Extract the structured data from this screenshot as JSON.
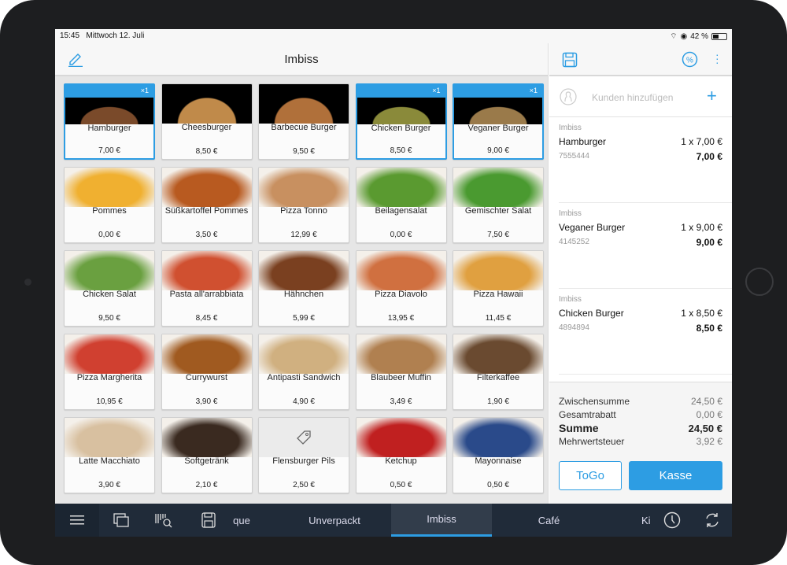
{
  "status": {
    "time": "15:45",
    "date": "Mittwoch 12. Juli",
    "battery": "42 %"
  },
  "left": {
    "title": "Imbiss",
    "icon": "pencil-icon"
  },
  "products": [
    {
      "name": "Hamburger",
      "price": "7,00 €",
      "qty": "×1",
      "selected": true,
      "color": "#7a4a2a"
    },
    {
      "name": "Cheesburger",
      "price": "8,50 €",
      "selected": false,
      "color": "#c08a4a"
    },
    {
      "name": "Barbecue Burger",
      "price": "9,50 €",
      "selected": false,
      "color": "#b0703a"
    },
    {
      "name": "Chicken Burger",
      "price": "8,50 €",
      "qty": "×1",
      "selected": true,
      "color": "#8a8a3a"
    },
    {
      "name": "Veganer Burger",
      "price": "9,00 €",
      "qty": "×1",
      "selected": true,
      "color": "#9a7a4a"
    },
    {
      "name": "Pommes",
      "price": "0,00 €",
      "selected": false,
      "color": "#f0b030"
    },
    {
      "name": "Süßkartoffel Pommes",
      "price": "3,50 €",
      "selected": false,
      "color": "#b85a20"
    },
    {
      "name": "Pizza Tonno",
      "price": "12,99 €",
      "selected": false,
      "color": "#c89060"
    },
    {
      "name": "Beilagensalat",
      "price": "0,00 €",
      "selected": false,
      "color": "#5a9a30"
    },
    {
      "name": "Gemischter Salat",
      "price": "7,50 €",
      "selected": false,
      "color": "#4a9a30"
    },
    {
      "name": "Chicken Salat",
      "price": "9,50 €",
      "selected": false,
      "color": "#6aa040"
    },
    {
      "name": "Pasta all'arrabbiata",
      "price": "8,45 €",
      "selected": false,
      "color": "#d05030"
    },
    {
      "name": "Hähnchen",
      "price": "5,99 €",
      "selected": false,
      "color": "#7a4020"
    },
    {
      "name": "Pizza Diavolo",
      "price": "13,95 €",
      "selected": false,
      "color": "#d07040"
    },
    {
      "name": "Pizza Hawaii",
      "price": "11,45 €",
      "selected": false,
      "color": "#e0a040"
    },
    {
      "name": "Pizza Margherita",
      "price": "10,95 €",
      "selected": false,
      "color": "#d04030"
    },
    {
      "name": "Currywurst",
      "price": "3,90 €",
      "selected": false,
      "color": "#a05a20"
    },
    {
      "name": "Antipasti Sandwich",
      "price": "4,90 €",
      "selected": false,
      "color": "#d0b080"
    },
    {
      "name": "Blaubeer Muffin",
      "price": "3,49 €",
      "selected": false,
      "color": "#b08050"
    },
    {
      "name": "Filterkaffee",
      "price": "1,90 €",
      "selected": false,
      "color": "#6a4a30"
    },
    {
      "name": "Latte Macchiato",
      "price": "3,90 €",
      "selected": false,
      "color": "#d8c0a0"
    },
    {
      "name": "Softgetränk",
      "price": "2,10 €",
      "selected": false,
      "color": "#3a2a20"
    },
    {
      "name": "Flensburger Pils",
      "price": "2,50 €",
      "selected": false,
      "color": "#e8e8e8",
      "placeholder_icon": "tag-icon"
    },
    {
      "name": "Ketchup",
      "price": "0,50 €",
      "selected": false,
      "color": "#c02020"
    },
    {
      "name": "Mayonnaise",
      "price": "0,50 €",
      "selected": false,
      "color": "#2a4a8a"
    }
  ],
  "cart": {
    "customer_placeholder": "Kunden hinzufügen",
    "items": [
      {
        "category": "Imbiss",
        "name": "Hamburger",
        "qty": "1 x 7,00 €",
        "sku": "7555444",
        "total": "7,00 €"
      },
      {
        "category": "Imbiss",
        "name": "Veganer Burger",
        "qty": "1 x 9,00 €",
        "sku": "4145252",
        "total": "9,00 €"
      },
      {
        "category": "Imbiss",
        "name": "Chicken Burger",
        "qty": "1 x 8,50 €",
        "sku": "4894894",
        "total": "8,50 €"
      }
    ],
    "totals": [
      {
        "label": "Zwischensumme",
        "value": "24,50 €"
      },
      {
        "label": "Gesamtrabatt",
        "value": "0,00 €"
      },
      {
        "label": "Summe",
        "value": "24,50 €"
      },
      {
        "label": "Mehrwertsteuer",
        "value": "3,92 €"
      }
    ],
    "togo": "ToGo",
    "kasse": "Kasse"
  },
  "nav": {
    "tabs": [
      "que",
      "Unverpackt",
      "Imbiss",
      "Café",
      "Ki"
    ],
    "active": "Imbiss"
  },
  "colors": {
    "accent": "#2d9de3",
    "nav": "#202b39"
  }
}
